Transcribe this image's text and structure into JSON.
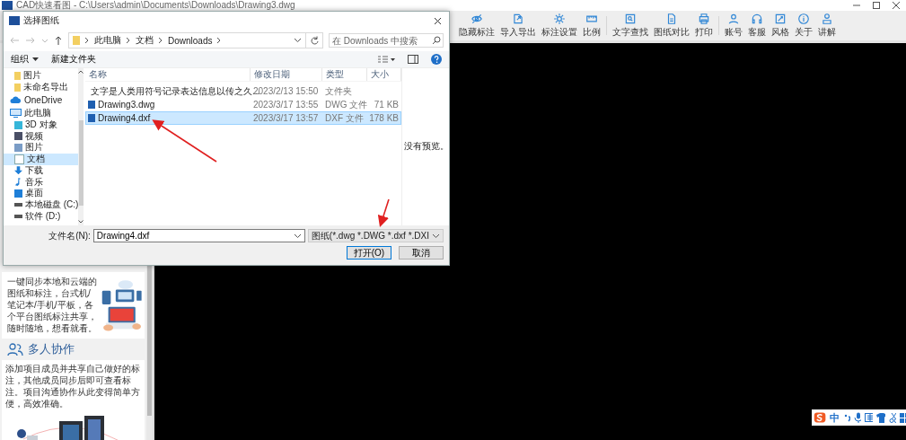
{
  "app": {
    "title": "CAD快速看图 - C:\\Users\\admin\\Documents\\Downloads\\Drawing3.dwg",
    "toolbar": [
      {
        "label": "隐藏标注"
      },
      {
        "label": "导入导出"
      },
      {
        "label": "标注设置"
      },
      {
        "label": "比例"
      },
      {
        "label": "文字查找"
      },
      {
        "label": "图纸对比"
      },
      {
        "label": "打印"
      },
      {
        "label": "账号"
      },
      {
        "label": "客服"
      },
      {
        "label": "风格"
      },
      {
        "label": "关于"
      },
      {
        "label": "讲解"
      }
    ]
  },
  "dialog": {
    "title": "选择图纸",
    "breadcrumb": [
      "此电脑",
      "文档",
      "Downloads"
    ],
    "search": {
      "placeholder": "在 Downloads 中搜索"
    },
    "commands": [
      {
        "label": "组织",
        "dropdown": true
      },
      {
        "label": "新建文件夹",
        "dropdown": false
      }
    ],
    "quick_access": [
      {
        "label": "图片",
        "selected": false
      },
      {
        "label": "未命名导出",
        "selected": false
      }
    ],
    "nav": [
      {
        "label": "OneDrive",
        "selected": false
      },
      {
        "label": "此电脑",
        "selected": false,
        "children": [
          {
            "label": "3D 对象",
            "selected": false
          },
          {
            "label": "视频",
            "selected": false
          },
          {
            "label": "图片",
            "selected": false
          },
          {
            "label": "文档",
            "selected": true
          },
          {
            "label": "下载",
            "selected": false
          },
          {
            "label": "音乐",
            "selected": false
          },
          {
            "label": "桌面",
            "selected": false
          },
          {
            "label": "本地磁盘 (C:)",
            "selected": false
          },
          {
            "label": "软件 (D:)",
            "selected": false
          }
        ]
      }
    ],
    "columns": [
      "名称",
      "修改日期",
      "类型",
      "大小"
    ],
    "files": [
      {
        "kind": "folder",
        "name": "文字是人类用符号记录表达信息以传之久...",
        "date": "2023/2/13 15:50",
        "type": "文件夹",
        "selected": false
      },
      {
        "kind": "file",
        "name": "Drawing3.dwg",
        "date": "2023/3/17 13:55",
        "type": "DWG 文件",
        "size": "71 KB",
        "selected": false
      },
      {
        "kind": "file",
        "name": "Drawing4.dxf",
        "date": "2023/3/17 13:57",
        "type": "DXF 文件",
        "size": "178 KB",
        "selected": true
      }
    ],
    "preview": "没有预览。",
    "filename_label": "文件名(N):",
    "filename": "Drawing4.dxf",
    "filter": "图纸(*.dwg *.DWG *.dxf *.DXI",
    "open_button": "打开(O)",
    "cancel_button": "取消"
  },
  "side_panel": {
    "sections": [
      {
        "paragraph": "一键同步本地和云端的图纸和标注，台式机/笔记本/手机/平板，各个平台图纸标注共享，随时随地，想看就看。"
      },
      {
        "heading": "多人协作",
        "paragraph": "添加项目成员并共享自己做好的标注，其他成员同步后即可查看标注。项目沟通协作从此变得简单方便，高效准确。"
      }
    ]
  },
  "ime": {
    "mode": "中"
  }
}
